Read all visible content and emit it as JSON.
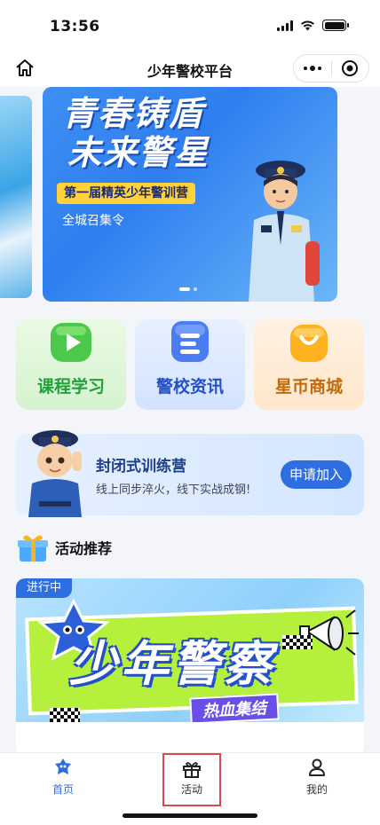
{
  "status_bar": {
    "time": "13:56"
  },
  "nav": {
    "title": "少年警校平台"
  },
  "banner": {
    "title_line1": "青春铸盾",
    "title_line2": "未来警星",
    "tag": "第一届精英少年警训营",
    "subtitle": "全城召集令",
    "slides": 2,
    "active_slide": 0
  },
  "features": [
    {
      "label": "课程学习",
      "color": "#22a03a",
      "icon": "play-icon"
    },
    {
      "label": "警校资讯",
      "color": "#2350c8",
      "icon": "news-icon"
    },
    {
      "label": "星币商城",
      "color": "#c26a0a",
      "icon": "shopping-bag-icon"
    }
  ],
  "camp": {
    "title": "封闭式训练营",
    "desc": "线上同步淬火，线下实战成钢!",
    "button": "申请加入"
  },
  "section": {
    "title": "活动推荐"
  },
  "activity": {
    "badge": "进行中",
    "title": "少年警察",
    "subtitle": "热血集结"
  },
  "tabs": [
    {
      "label": "首页",
      "icon": "home-mascot-icon",
      "active": true
    },
    {
      "label": "活动",
      "icon": "gift-icon",
      "active": false
    },
    {
      "label": "我的",
      "icon": "user-icon",
      "active": false
    }
  ],
  "colors": {
    "accent": "#2d6fe0",
    "highlight_border": "#d94a4a"
  }
}
